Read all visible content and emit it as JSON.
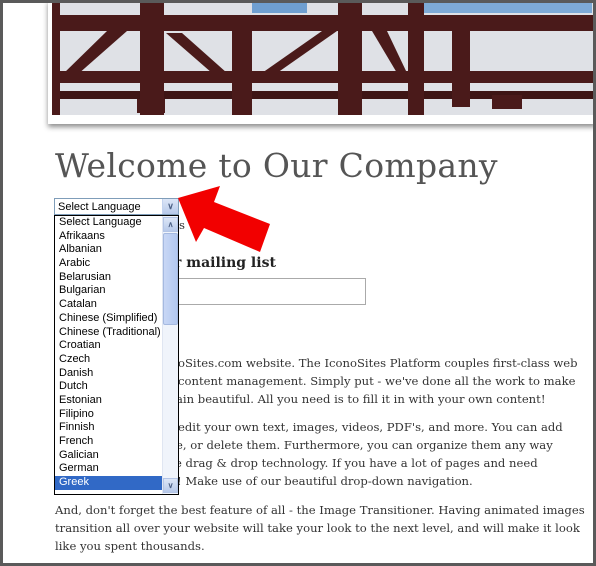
{
  "page": {
    "title": "Welcome to Our Company"
  },
  "language_select": {
    "selected": "Select Language",
    "options": [
      "Select Language",
      "Afrikaans",
      "Albanian",
      "Arabic",
      "Belarusian",
      "Bulgarian",
      "Catalan",
      "Chinese (Simplified)",
      "Chinese (Traditional)",
      "Croatian",
      "Czech",
      "Danish",
      "Dutch",
      "Estonian",
      "Filipino",
      "Finnish",
      "French",
      "Galician",
      "German",
      "Greek"
    ],
    "highlighted": "Greek",
    "highlight_color": "#3169c6"
  },
  "annotation": {
    "arrow_color": "#ff0000"
  },
  "behind_select_fragment": "s",
  "mailing_list": {
    "heading_fragment": "r mailing list",
    "input_value": ""
  },
  "body_fragments": [
    "oSites.com website.  The IconoSites Platform couples first-class web",
    "content management.   Simply put - we've done all the work to make",
    "ain beautiful.  All you need is to fill it in with your own content!",
    "edit your own text, images, videos, PDF's, and more.  You can add",
    "e, or delete them.  Furthermore, you can organize them any way",
    "e drag & drop technology.  If you have a lot of pages and need",
    "!  Make use of our beautiful drop-down navigation."
  ],
  "final_paragraph": [
    "And, don't forget the best feature of all - the Image Transitioner.  Having animated images",
    "transition all over your website will take your look to the next level, and will make it look",
    "like you spent thousands."
  ]
}
